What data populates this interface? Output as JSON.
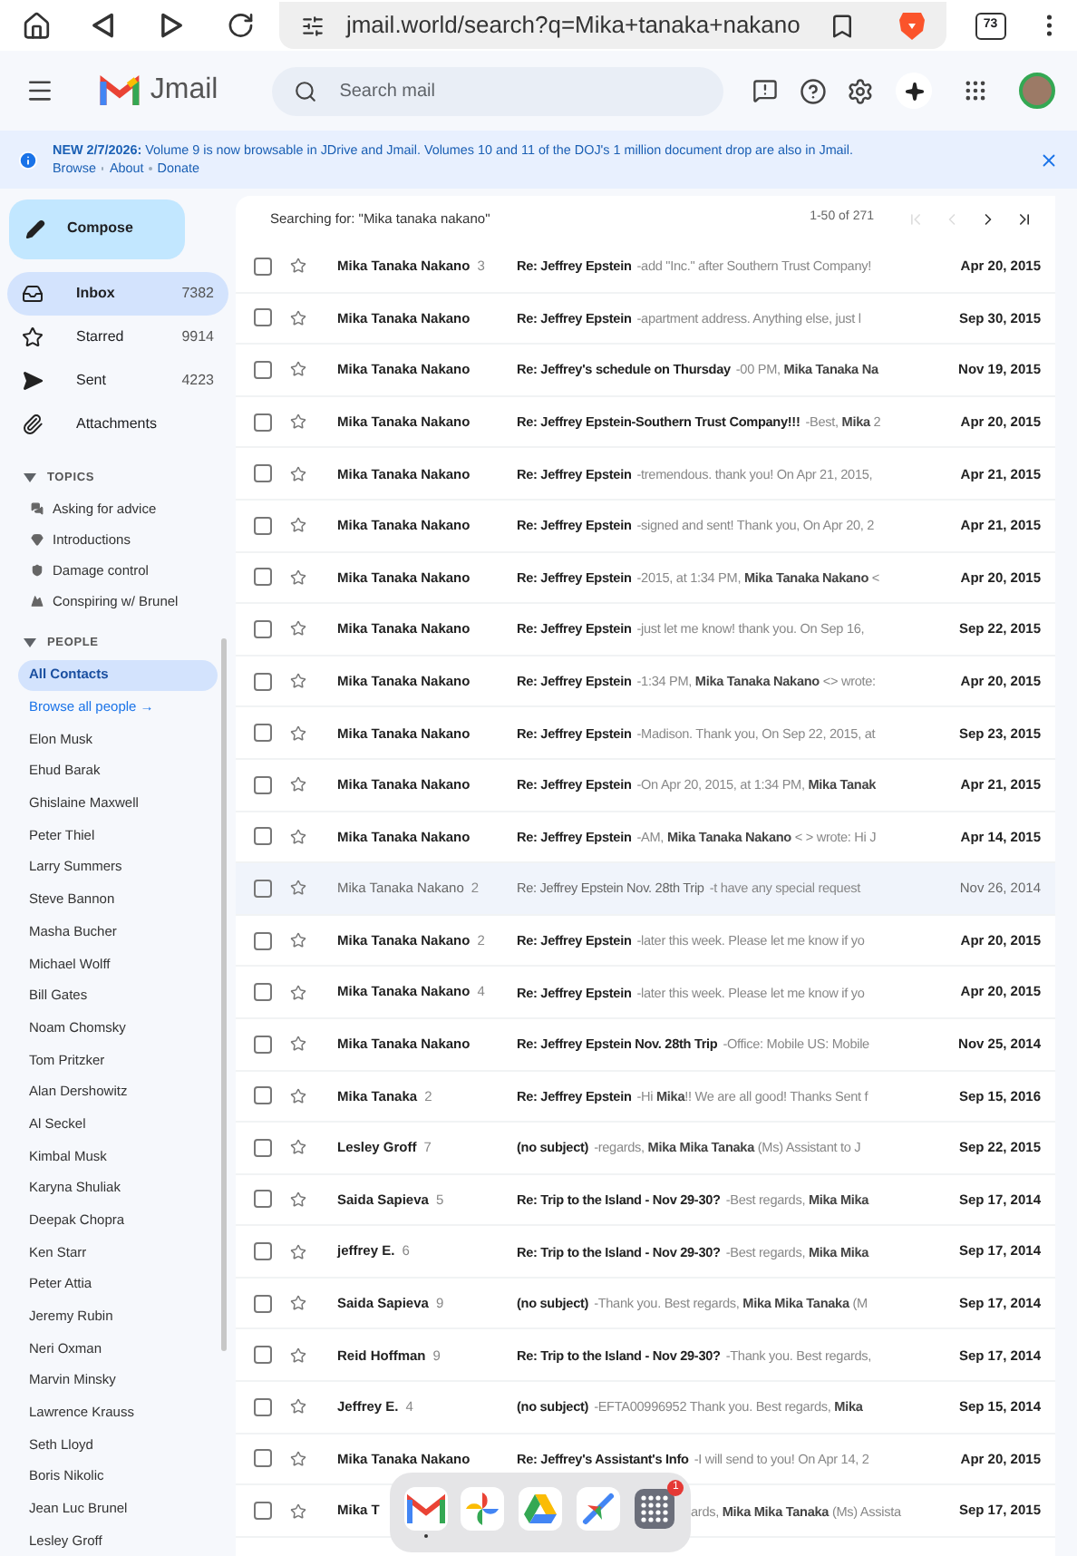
{
  "browser": {
    "url": "jmail.world/search?q=Mika+tanaka+nakano",
    "tab_count": "73"
  },
  "app": {
    "name": "Jmail",
    "search_placeholder": "Search mail"
  },
  "banner": {
    "text": "**NEW 2/7/2026:** Volume 9 is now browsable in JDrive and Jmail. Volumes 10 and 11 of the DOJ's 1 million document drop are also in Jmail.",
    "links": [
      "Browse",
      "About",
      "Donate"
    ]
  },
  "sidebar": {
    "compose": "Compose",
    "folders": [
      {
        "label": "Inbox",
        "count": "7382",
        "selected": true
      },
      {
        "label": "Starred",
        "count": "9914",
        "selected": false
      },
      {
        "label": "Sent",
        "count": "4223",
        "selected": false
      },
      {
        "label": "Attachments",
        "selected": false
      }
    ],
    "topics": {
      "heading": "TOPICS",
      "expanded": true,
      "items": [
        "Asking for advice",
        "Introductions",
        "Damage control",
        "Conspiring w/ Brunel"
      ]
    },
    "people": {
      "heading": "PEOPLE",
      "expanded": true,
      "items": [
        {
          "label": "All Contacts",
          "kind": "filter",
          "selected": true
        },
        {
          "label": "Browse all people →",
          "kind": "link",
          "selected": false
        },
        {
          "label": "Elon Musk",
          "kind": "person",
          "selected": false
        },
        {
          "label": "Ehud Barak",
          "kind": "person",
          "selected": false
        },
        {
          "label": "Ghislaine Maxwell",
          "kind": "person",
          "selected": false
        },
        {
          "label": "Peter Thiel",
          "kind": "person",
          "selected": false
        },
        {
          "label": "Larry Summers",
          "kind": "person",
          "selected": false
        },
        {
          "label": "Steve Bannon",
          "kind": "person",
          "selected": false
        },
        {
          "label": "Masha Bucher",
          "kind": "person",
          "selected": false
        },
        {
          "label": "Michael Wolff",
          "kind": "person",
          "selected": false
        },
        {
          "label": "Bill Gates",
          "kind": "person",
          "selected": false
        },
        {
          "label": "Noam Chomsky",
          "kind": "person",
          "selected": false
        },
        {
          "label": "Tom Pritzker",
          "kind": "person",
          "selected": false
        },
        {
          "label": "Alan Dershowitz",
          "kind": "person",
          "selected": false
        },
        {
          "label": "Al Seckel",
          "kind": "person",
          "selected": false
        },
        {
          "label": "Kimbal Musk",
          "kind": "person",
          "selected": false
        },
        {
          "label": "Karyna Shuliak",
          "kind": "person",
          "selected": false
        },
        {
          "label": "Deepak Chopra",
          "kind": "person",
          "selected": false
        },
        {
          "label": "Ken Starr",
          "kind": "person",
          "selected": false
        },
        {
          "label": "Peter Attia",
          "kind": "person",
          "selected": false
        },
        {
          "label": "Jeremy Rubin",
          "kind": "person",
          "selected": false
        },
        {
          "label": "Neri Oxman",
          "kind": "person",
          "selected": false
        },
        {
          "label": "Marvin Minsky",
          "kind": "person",
          "selected": false
        },
        {
          "label": "Lawrence Krauss",
          "kind": "person",
          "selected": false
        },
        {
          "label": "Seth Lloyd",
          "kind": "person",
          "selected": false
        },
        {
          "label": "Boris Nikolic",
          "kind": "person",
          "selected": false
        },
        {
          "label": "Jean Luc Brunel",
          "kind": "person",
          "selected": false
        },
        {
          "label": "Lesley Groff",
          "kind": "person",
          "selected": false
        }
      ]
    }
  },
  "results": {
    "query": "Searching for: \"Mika tanaka nakano\"",
    "range": "1-50 of 271",
    "pager": [
      {
        "kind": "first",
        "disabled": true
      },
      {
        "kind": "prev",
        "disabled": true
      },
      {
        "kind": "next",
        "disabled": false
      },
      {
        "kind": "last",
        "disabled": false
      }
    ]
  },
  "emails": [
    {
      "sender": "Mika Tanaka Nakano",
      "count": "3",
      "subject": "Re: Jeffrey Epstein",
      "snippet": "-add \"Inc.\" after Southern Trust Company!",
      "date": "Apr 20, 2015",
      "read": false,
      "checked": false,
      "starred": false
    },
    {
      "sender": "Mika Tanaka Nakano",
      "subject": "Re: Jeffrey Epstein",
      "snippet": "-apartment address. Anything else, just l",
      "date": "Sep 30, 2015",
      "read": false,
      "checked": false,
      "starred": false
    },
    {
      "sender": "Mika Tanaka Nakano",
      "subject": "Re: Jeffrey's schedule on Thursday",
      "snippet": "-00 PM, **Mika Tanaka Na**",
      "date": "Nov 19, 2015",
      "read": false,
      "checked": false,
      "starred": false
    },
    {
      "sender": "Mika Tanaka Nakano",
      "subject": "Re: Jeffrey Epstein-Southern Trust Company!!!",
      "snippet": "-Best, **Mika** 2",
      "date": "Apr 20, 2015",
      "read": false,
      "checked": false,
      "starred": false
    },
    {
      "sender": "Mika Tanaka Nakano",
      "subject": "Re: Jeffrey Epstein",
      "snippet": "-tremendous. thank you! On Apr 21, 2015,",
      "date": "Apr 21, 2015",
      "read": false,
      "checked": false,
      "starred": false
    },
    {
      "sender": "Mika Tanaka Nakano",
      "subject": "Re: Jeffrey Epstein",
      "snippet": "-signed and sent! Thank you, On Apr 20, 2",
      "date": "Apr 21, 2015",
      "read": false,
      "checked": false,
      "starred": false
    },
    {
      "sender": "Mika Tanaka Nakano",
      "subject": "Re: Jeffrey Epstein",
      "snippet": "-2015, at 1:34 PM, **Mika Tanaka Nakano** <",
      "date": "Apr 20, 2015",
      "read": false,
      "checked": false,
      "starred": false
    },
    {
      "sender": "Mika Tanaka Nakano",
      "subject": "Re: Jeffrey Epstein",
      "snippet": "-just let me know! thank you. On Sep 16,",
      "date": "Sep 22, 2015",
      "read": false,
      "checked": false,
      "starred": false
    },
    {
      "sender": "Mika Tanaka Nakano",
      "subject": "Re: Jeffrey Epstein",
      "snippet": "-1:34 PM, **Mika Tanaka Nakano** <> wrote:",
      "date": "Apr 20, 2015",
      "read": false,
      "checked": false,
      "starred": false
    },
    {
      "sender": "Mika Tanaka Nakano",
      "subject": "Re: Jeffrey Epstein",
      "snippet": "-Madison. Thank you, On Sep 22, 2015, at",
      "date": "Sep 23, 2015",
      "read": false,
      "checked": false,
      "starred": false
    },
    {
      "sender": "Mika Tanaka Nakano",
      "subject": "Re: Jeffrey Epstein",
      "snippet": "-On Apr 20, 2015, at 1:34 PM, **Mika Tanak**",
      "date": "Apr 21, 2015",
      "read": false,
      "checked": false,
      "starred": false
    },
    {
      "sender": "Mika Tanaka Nakano",
      "subject": "Re: Jeffrey Epstein",
      "snippet": "-AM, **Mika Tanaka Nakano** < > wrote: Hi J",
      "date": "Apr 14, 2015",
      "read": false,
      "checked": false,
      "starred": false
    },
    {
      "sender": "Mika Tanaka Nakano",
      "count": "2",
      "subject": "Re: Jeffrey Epstein Nov. 28th Trip",
      "snippet": "-t have any special request",
      "date": "Nov 26, 2014",
      "read": true,
      "checked": false,
      "starred": false
    },
    {
      "sender": "Mika Tanaka Nakano",
      "count": "2",
      "subject": "Re: Jeffrey Epstein",
      "snippet": "-later this week. Please let me know if yo",
      "date": "Apr 20, 2015",
      "read": false,
      "checked": false,
      "starred": false
    },
    {
      "sender": "Mika Tanaka Nakano",
      "count": "4",
      "subject": "Re: Jeffrey Epstein",
      "snippet": "-later this week. Please let me know if yo",
      "date": "Apr 20, 2015",
      "read": false,
      "checked": false,
      "starred": false
    },
    {
      "sender": "Mika Tanaka Nakano",
      "subject": "Re: Jeffrey Epstein Nov. 28th Trip",
      "snippet": "-Office: Mobile US: Mobile",
      "date": "Nov 25, 2014",
      "read": false,
      "checked": false,
      "starred": false
    },
    {
      "sender": "Mika Tanaka",
      "count": "2",
      "subject": "Re: Jeffrey Epstein",
      "snippet": "-Hi **Mika**!! We are all good! Thanks Sent f",
      "date": "Sep 15, 2016",
      "read": false,
      "checked": false,
      "starred": false
    },
    {
      "sender": "Lesley Groff",
      "count": "7",
      "subject": "(no subject)",
      "snippet": "-regards, **Mika Mika Tanaka** (Ms) Assistant to J",
      "date": "Sep 22, 2015",
      "read": false,
      "checked": false,
      "starred": false
    },
    {
      "sender": "Saida Sapieva",
      "count": "5",
      "subject": "Re: Trip to the Island - Nov 29-30?",
      "snippet": "-Best regards, **Mika Mika**",
      "date": "Sep 17, 2014",
      "read": false,
      "checked": false,
      "starred": false
    },
    {
      "sender": "jeffrey E.",
      "count": "6",
      "subject": "Re: Trip to the Island - Nov 29-30?",
      "snippet": "-Best regards, **Mika Mika**",
      "date": "Sep 17, 2014",
      "read": false,
      "checked": false,
      "starred": false
    },
    {
      "sender": "Saida Sapieva",
      "count": "9",
      "subject": "(no subject)",
      "snippet": "-Thank you. Best regards, **Mika Mika Tanaka** (M",
      "date": "Sep 17, 2014",
      "read": false,
      "checked": false,
      "starred": false
    },
    {
      "sender": "Reid Hoffman",
      "count": "9",
      "subject": "Re: Trip to the Island - Nov 29-30?",
      "snippet": "-Thank you. Best regards,",
      "date": "Sep 17, 2014",
      "read": false,
      "checked": false,
      "starred": false
    },
    {
      "sender": "Jeffrey E.",
      "count": "4",
      "subject": "(no subject)",
      "snippet": "-EFTA00996952 Thank you. Best regards, **Mika**",
      "date": "Sep 15, 2014",
      "read": false,
      "checked": false,
      "starred": false
    },
    {
      "sender": "Mika Tanaka Nakano",
      "subject": "Re: Jeffrey's Assistant's Info",
      "snippet": "-I will send to you! On Apr 14, 2",
      "date": "Apr 20, 2015",
      "read": false,
      "checked": false,
      "starred": false
    },
    {
      "sender": "Mika T",
      "snippet": "ards, **Mika Mika Tanaka** (Ms) Assista",
      "date": "Sep 17, 2015",
      "read": false,
      "checked": false,
      "starred": false
    }
  ],
  "dock": {
    "apps": [
      {
        "kind": "mail",
        "selected": true
      },
      {
        "kind": "pinwheel",
        "selected": false
      },
      {
        "kind": "drive",
        "selected": false
      },
      {
        "kind": "plane",
        "selected": false
      },
      {
        "kind": "grid",
        "selected": false,
        "badge": "1"
      }
    ]
  }
}
